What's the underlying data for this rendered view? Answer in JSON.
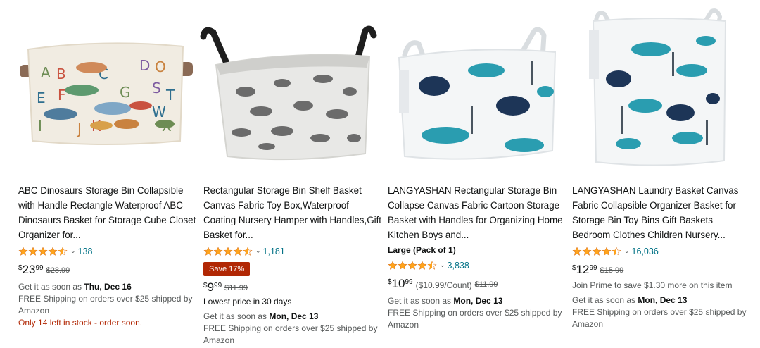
{
  "products": [
    {
      "title": "ABC Dinosaurs Storage Bin Collapsible with Handle Rectangle Waterproof ABC Dinosaurs Basket for Storage Cube Closet Organizer for...",
      "rating": 4.5,
      "review_count": "138",
      "price_symbol": "$",
      "price_whole": "23",
      "price_fraction": "99",
      "was_price": "$28.99",
      "delivery_prefix": "Get it as soon as ",
      "delivery_date": "Thu, Dec 16",
      "shipping": "FREE Shipping on orders over $25 shipped by Amazon",
      "stock": "Only 14 left in stock - order soon."
    },
    {
      "title": "Rectangular Storage Bin Shelf Basket Canvas Fabric Toy Box,Waterproof Coating Nursery Hamper with Handles,Gift Basket for...",
      "rating": 4.5,
      "review_count": "1,181",
      "badge": "Save 17%",
      "price_symbol": "$",
      "price_whole": "9",
      "price_fraction": "99",
      "was_price": "$11.99",
      "lowest_note": "Lowest price in 30 days",
      "delivery_prefix": "Get it as soon as ",
      "delivery_date": "Mon, Dec 13",
      "shipping": "FREE Shipping on orders over $25 shipped by Amazon"
    },
    {
      "title": "LANGYASHAN Rectangular Storage Bin Collapse Canvas Fabric Cartoon Storage Basket with Handles for Organizing Home Kitchen Boys and...",
      "variant": "Large (Pack of 1)",
      "rating": 4.5,
      "review_count": "3,838",
      "price_symbol": "$",
      "price_whole": "10",
      "price_fraction": "99",
      "unit_price": "($10.99/Count)",
      "was_price": "$11.99",
      "delivery_prefix": "Get it as soon as ",
      "delivery_date": "Mon, Dec 13",
      "shipping": "FREE Shipping on orders over $25 shipped by Amazon"
    },
    {
      "title": "LANGYASHAN Laundry Basket Canvas Fabric Collapsible Organizer Basket for Storage Bin Toy Bins Gift Baskets Bedroom Clothes Children Nursery...",
      "rating": 4.5,
      "review_count": "16,036",
      "price_symbol": "$",
      "price_whole": "12",
      "price_fraction": "99",
      "was_price": "$15.99",
      "prime_note": "Join Prime to save $1.30 more on this item",
      "delivery_prefix": "Get it as soon as ",
      "delivery_date": "Mon, Dec 13",
      "shipping": "FREE Shipping on orders over $25 shipped by Amazon"
    }
  ],
  "colors": {
    "star": "#ffa41c",
    "link": "#007185",
    "deal": "#b12704",
    "teal_print": "#2a9db0",
    "navy_print": "#1d3557",
    "gray_print": "#5f6368"
  },
  "icons": {
    "rating": "star-icon",
    "dropdown": "chevron-down-icon"
  }
}
